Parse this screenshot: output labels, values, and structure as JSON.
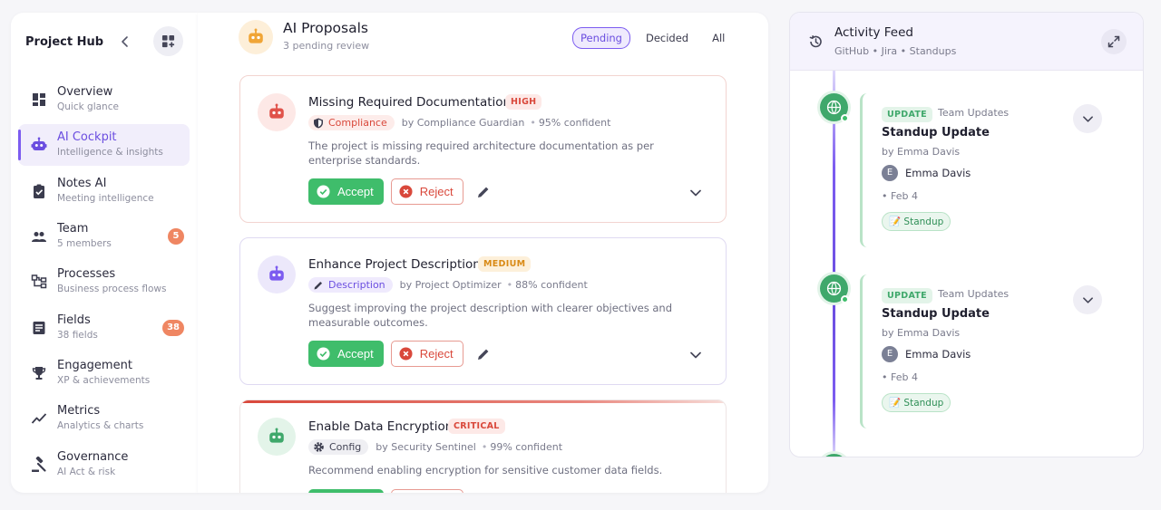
{
  "sidebar": {
    "title": "Project Hub",
    "items": [
      {
        "label": "Overview",
        "sub": "Quick glance",
        "icon": "dashboard-icon"
      },
      {
        "label": "AI Cockpit",
        "sub": "Intelligence & insights",
        "icon": "robot-icon",
        "active": true
      },
      {
        "label": "Notes AI",
        "sub": "Meeting intelligence",
        "icon": "clipboard-icon"
      },
      {
        "label": "Team",
        "sub": "5 members",
        "icon": "people-icon",
        "badge": "5"
      },
      {
        "label": "Processes",
        "sub": "Business process flows",
        "icon": "flow-icon"
      },
      {
        "label": "Fields",
        "sub": "38 fields",
        "icon": "list-icon",
        "badge": "38"
      },
      {
        "label": "Engagement",
        "sub": "XP & achievements",
        "icon": "trophy-icon"
      },
      {
        "label": "Metrics",
        "sub": "Analytics & charts",
        "icon": "trend-icon"
      },
      {
        "label": "Governance",
        "sub": "AI Act & risk",
        "icon": "gavel-icon"
      }
    ]
  },
  "proposals": {
    "title": "AI Proposals",
    "subtitle": "3 pending review",
    "filters": [
      "Pending",
      "Decided",
      "All"
    ],
    "active_filter": "Pending",
    "accept_label": "Accept",
    "reject_label": "Reject",
    "cards": [
      {
        "title": "Missing Required Documentation",
        "severity": "HIGH",
        "category": "Compliance",
        "agent": "by Compliance Guardian",
        "confidence": "95% confident",
        "description": "The project is missing required architecture documentation as per enterprise standards."
      },
      {
        "title": "Enhance Project Description",
        "severity": "MEDIUM",
        "category": "Description",
        "agent": "by Project Optimizer",
        "confidence": "88% confident",
        "description": "Suggest improving the project description with clearer objectives and measurable outcomes."
      },
      {
        "title": "Enable Data Encryption",
        "severity": "CRITICAL",
        "category": "Config",
        "agent": "by Security Sentinel",
        "confidence": "99% confident",
        "description": "Recommend enabling encryption for sensitive customer data fields."
      }
    ]
  },
  "feed": {
    "title": "Activity Feed",
    "subtitle": "GitHub • Jira • Standups",
    "entries": [
      {
        "tag": "UPDATE",
        "source": "Team Updates",
        "title": "Standup Update",
        "by": "by Emma Davis",
        "person": "Emma Davis",
        "initial": "E",
        "date": "Feb 4",
        "chip": "Standup"
      },
      {
        "tag": "UPDATE",
        "source": "Team Updates",
        "title": "Standup Update",
        "by": "by Emma Davis",
        "person": "Emma Davis",
        "initial": "E",
        "date": "Feb 4",
        "chip": "Standup"
      }
    ]
  },
  "colors": {
    "accent": "#7c5cf0",
    "success": "#3fbd6b",
    "danger": "#d9483b",
    "warning": "#d98a15",
    "badge": "#ef8662"
  }
}
